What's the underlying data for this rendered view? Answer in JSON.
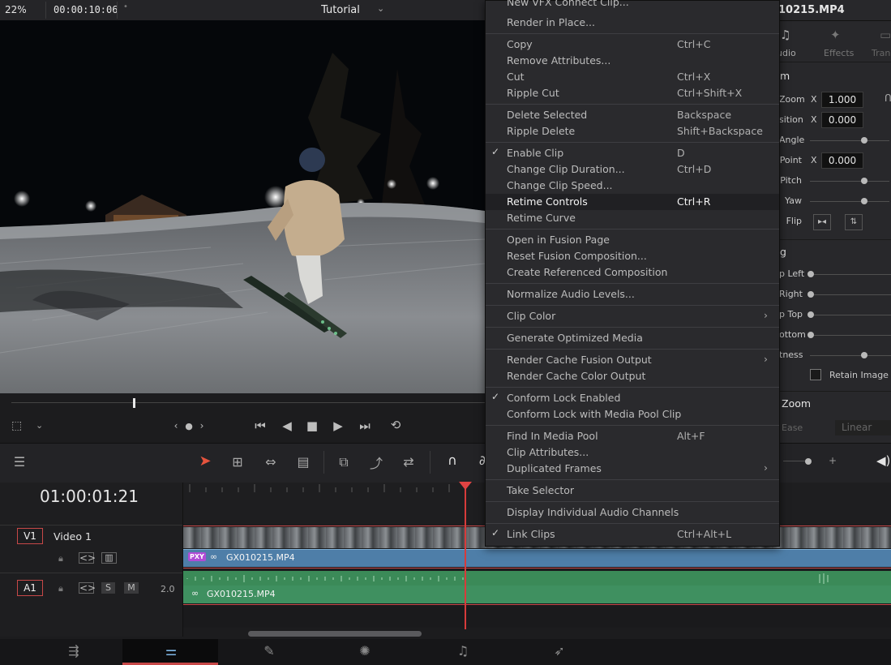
{
  "viewer": {
    "zoom": "22%",
    "timecode": "00:00:10:06",
    "title": "Tutorial",
    "scrub_position": 0.25
  },
  "timeline": {
    "timecode": "01:00:01:21",
    "tracks": {
      "v1": {
        "label": "V1",
        "name": "Video 1",
        "clip": "GX010215.MP4",
        "proxy_badge": "PXY"
      },
      "a1": {
        "label": "A1",
        "channels": "2.0",
        "solo": "S",
        "mute": "M",
        "clip": "GX010215.MP4"
      }
    }
  },
  "inspector": {
    "title": "10215.MP4",
    "tabs": [
      "udio",
      "Effects",
      "Tran"
    ],
    "section": "m",
    "fields": {
      "zoom": {
        "label": "Zoom",
        "axis": "X",
        "value": "1.000"
      },
      "position": {
        "label": "sition",
        "axis": "X",
        "value": "0.000"
      },
      "angle": {
        "label": "Angle"
      },
      "anchor": {
        "label": "Point",
        "axis": "X",
        "value": "0.000"
      },
      "pitch": {
        "label": "Pitch"
      },
      "yaw": {
        "label": "Yaw"
      },
      "flip": {
        "label": "Flip"
      }
    },
    "crop_section": "g",
    "crop": {
      "left": "p Left",
      "right": "Right",
      "top": "p Top",
      "bottom": "ottom",
      "softness": "tness",
      "retain": "Retain Image P"
    },
    "dynamic_zoom": "Zoom",
    "ease_label": "Ease",
    "ease_value": "Linear"
  },
  "context_menu": {
    "items": [
      {
        "label": "New VFX Connect Clip...",
        "shortcut": "",
        "checked": false,
        "submenu": false
      },
      {
        "label": "Render in Place...",
        "shortcut": "",
        "checked": false,
        "submenu": false
      },
      {
        "label": "Copy",
        "shortcut": "Ctrl+C",
        "checked": false,
        "submenu": false
      },
      {
        "label": "Remove Attributes...",
        "shortcut": "",
        "checked": false,
        "submenu": false
      },
      {
        "label": "Cut",
        "shortcut": "Ctrl+X",
        "checked": false,
        "submenu": false
      },
      {
        "label": "Ripple Cut",
        "shortcut": "Ctrl+Shift+X",
        "checked": false,
        "submenu": false
      },
      {
        "label": "Delete Selected",
        "shortcut": "Backspace",
        "checked": false,
        "submenu": false
      },
      {
        "label": "Ripple Delete",
        "shortcut": "Shift+Backspace",
        "checked": false,
        "submenu": false
      },
      {
        "label": "Enable Clip",
        "shortcut": "D",
        "checked": true,
        "submenu": false
      },
      {
        "label": "Change Clip Duration...",
        "shortcut": "Ctrl+D",
        "checked": false,
        "submenu": false
      },
      {
        "label": "Change Clip Speed...",
        "shortcut": "",
        "checked": false,
        "submenu": false
      },
      {
        "label": "Retime Controls",
        "shortcut": "Ctrl+R",
        "checked": false,
        "submenu": false,
        "highlight": true
      },
      {
        "label": "Retime Curve",
        "shortcut": "",
        "checked": false,
        "submenu": false
      },
      {
        "label": "Open in Fusion Page",
        "shortcut": "",
        "checked": false,
        "submenu": false
      },
      {
        "label": "Reset Fusion Composition...",
        "shortcut": "",
        "checked": false,
        "submenu": false
      },
      {
        "label": "Create Referenced Composition",
        "shortcut": "",
        "checked": false,
        "submenu": false
      },
      {
        "label": "Normalize Audio Levels...",
        "shortcut": "",
        "checked": false,
        "submenu": false
      },
      {
        "label": "Clip Color",
        "shortcut": "",
        "checked": false,
        "submenu": true
      },
      {
        "label": "Generate Optimized Media",
        "shortcut": "",
        "checked": false,
        "submenu": false
      },
      {
        "label": "Render Cache Fusion Output",
        "shortcut": "",
        "checked": false,
        "submenu": true
      },
      {
        "label": "Render Cache Color Output",
        "shortcut": "",
        "checked": false,
        "submenu": false
      },
      {
        "label": "Conform Lock Enabled",
        "shortcut": "",
        "checked": true,
        "submenu": false
      },
      {
        "label": "Conform Lock with Media Pool Clip",
        "shortcut": "",
        "checked": false,
        "submenu": false
      },
      {
        "label": "Find In Media Pool",
        "shortcut": "Alt+F",
        "checked": false,
        "submenu": false
      },
      {
        "label": "Clip Attributes...",
        "shortcut": "",
        "checked": false,
        "submenu": false
      },
      {
        "label": "Duplicated Frames",
        "shortcut": "",
        "checked": false,
        "submenu": true
      },
      {
        "label": "Take Selector",
        "shortcut": "",
        "checked": false,
        "submenu": false
      },
      {
        "label": "Display Individual Audio Channels",
        "shortcut": "",
        "checked": false,
        "submenu": false
      },
      {
        "label": "Link Clips",
        "shortcut": "Ctrl+Alt+L",
        "checked": true,
        "submenu": false
      }
    ]
  },
  "colors": {
    "accent_red": "#d73b3b",
    "video_clip": "#4e7ea8",
    "audio_clip": "#3f9060"
  }
}
